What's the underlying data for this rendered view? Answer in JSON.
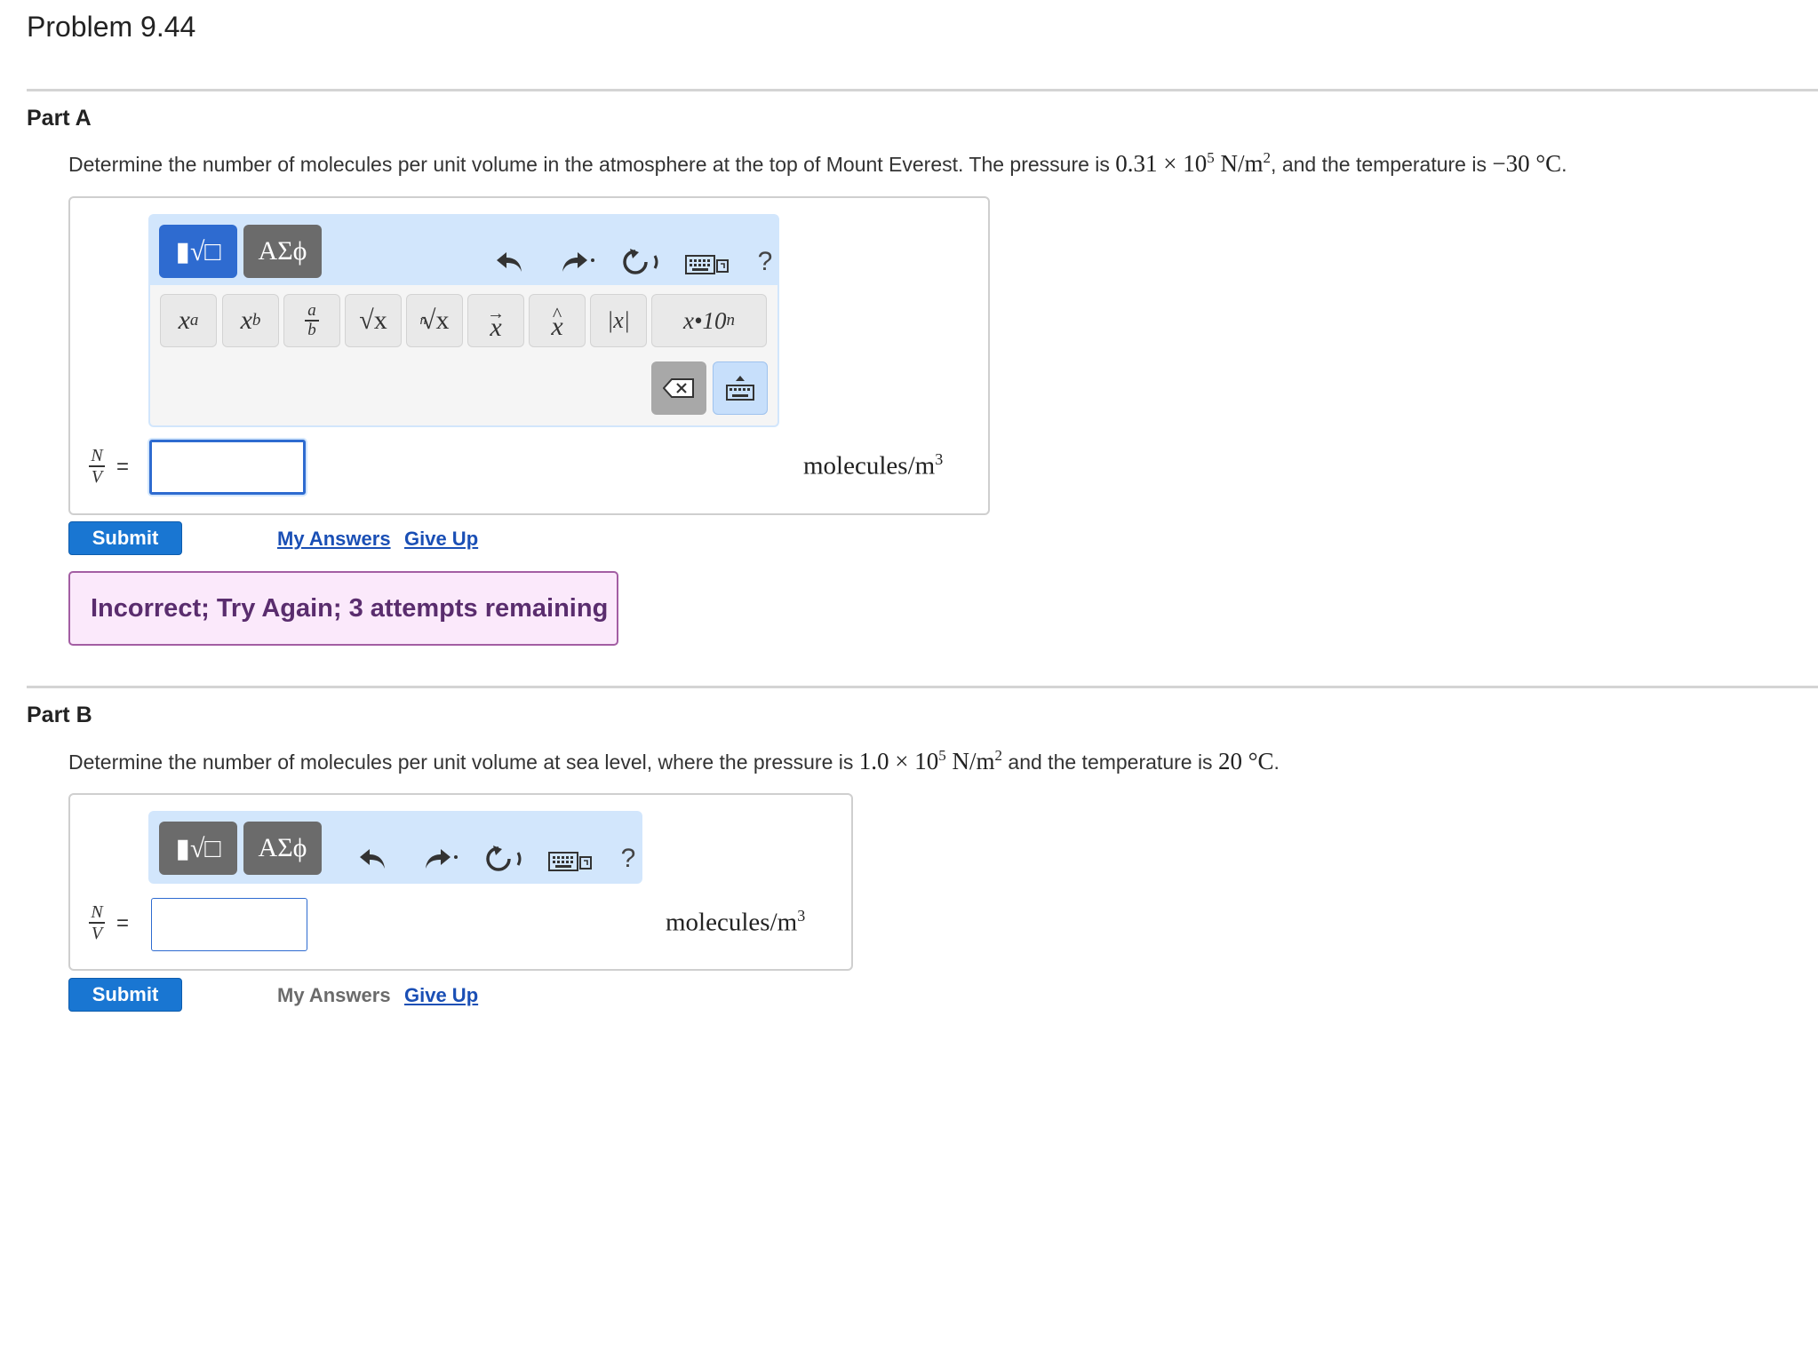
{
  "problem_title": "Problem 9.44",
  "part_a": {
    "title": "Part A",
    "question_prefix": "Determine the number of molecules per unit volume in the atmosphere at the top of Mount Everest. The pressure is ",
    "pressure_mantissa": "0.31",
    "times": "×",
    "pressure_base": "10",
    "pressure_exp": "5",
    "pressure_unit": "N/m",
    "pressure_unit_exp": "2",
    "mid_text": ", and the temperature is ",
    "temperature": "−30",
    "temp_unit": "°C",
    "end_text": ".",
    "toolbar": {
      "templates_label": "▮√□",
      "greek_label": "ΑΣϕ",
      "help_label": "?"
    },
    "palette": {
      "superscript_base": "x",
      "superscript_exp": "a",
      "subscript_base": "x",
      "subscript_sub": "b",
      "fraction_num": "a",
      "fraction_den": "b",
      "sqrt_label": "√x",
      "nthroot_index": "n",
      "nthroot_label": "√x",
      "vector_arrow": "→",
      "vector_label": "x",
      "hat_mark": "^",
      "hat_label": "x",
      "abs_label": "|x|",
      "sci_label": "x•10",
      "sci_exp": "n"
    },
    "label_n": "N",
    "label_v": "V",
    "equals": "=",
    "input_value": "",
    "unit_text": "molecules/m",
    "unit_exp": "3",
    "submit_label": "Submit",
    "my_answers_label": "My Answers",
    "give_up_label": "Give Up",
    "feedback": "Incorrect; Try Again; 3 attempts remaining"
  },
  "part_b": {
    "title": "Part B",
    "question_prefix": "Determine the number of molecules per unit volume at sea level, where the pressure is ",
    "pressure_mantissa": "1.0",
    "times": "×",
    "pressure_base": "10",
    "pressure_exp": "5",
    "pressure_unit": "N/m",
    "pressure_unit_exp": "2",
    "mid_text": " and the temperature is ",
    "temperature": "20",
    "temp_unit": "°C",
    "end_text": ".",
    "toolbar": {
      "templates_label": "▮√□",
      "greek_label": "ΑΣϕ",
      "help_label": "?"
    },
    "label_n": "N",
    "label_v": "V",
    "equals": "=",
    "input_value": "",
    "unit_text": "molecules/m",
    "unit_exp": "3",
    "submit_label": "Submit",
    "my_answers_label": "My Answers",
    "give_up_label": "Give Up"
  },
  "colors": {
    "accent_blue": "#1976d2",
    "toolbar_bg": "#d2e6fc",
    "feedback_bg": "#fbe9fb",
    "feedback_border": "#a35ea3",
    "feedback_text": "#5a2d6e",
    "link": "#1a4fb5"
  }
}
